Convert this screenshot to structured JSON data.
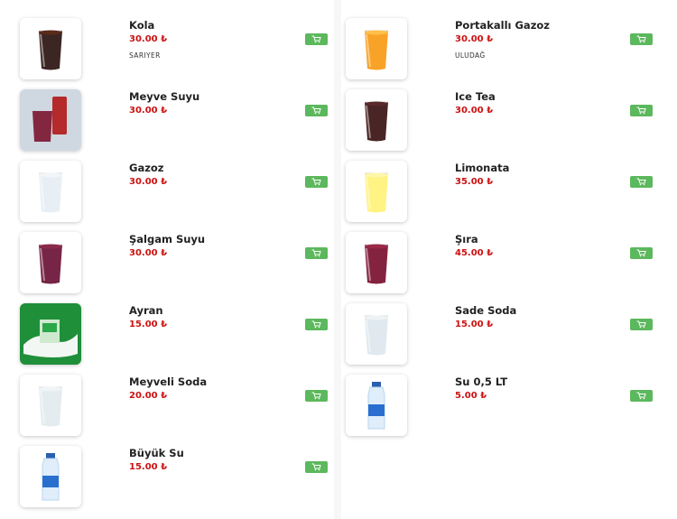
{
  "left_column": [
    {
      "name": "Kola",
      "price": "30.00 ₺",
      "brand": "SARIYER",
      "icon": "cola-glass-icon"
    },
    {
      "name": "Meyve Suyu",
      "price": "30.00 ₺",
      "brand": "",
      "icon": "juice-can-icon"
    },
    {
      "name": "Gazoz",
      "price": "30.00 ₺",
      "brand": "",
      "icon": "clear-soda-glass-icon"
    },
    {
      "name": "Şalgam Suyu",
      "price": "30.00 ₺",
      "brand": "",
      "icon": "turnip-juice-glass-icon"
    },
    {
      "name": "Ayran",
      "price": "15.00 ₺",
      "brand": "",
      "icon": "ayran-splash-icon"
    },
    {
      "name": "Meyveli Soda",
      "price": "20.00 ₺",
      "brand": "",
      "icon": "fruit-soda-glass-icon"
    },
    {
      "name": "Büyük Su",
      "price": "15.00 ₺",
      "brand": "",
      "icon": "large-water-bottle-icon"
    }
  ],
  "right_column": [
    {
      "name": "Portakallı Gazoz",
      "price": "30.00 ₺",
      "brand": "ULUDAĞ",
      "icon": "orange-soda-glass-icon"
    },
    {
      "name": "Ice Tea",
      "price": "30.00 ₺",
      "brand": "",
      "icon": "ice-tea-glass-icon"
    },
    {
      "name": "Limonata",
      "price": "35.00 ₺",
      "brand": "",
      "icon": "lemonade-glass-icon"
    },
    {
      "name": "Şıra",
      "price": "45.00 ₺",
      "brand": "",
      "icon": "sira-glass-icon"
    },
    {
      "name": "Sade Soda",
      "price": "15.00 ₺",
      "brand": "",
      "icon": "plain-soda-glass-icon"
    },
    {
      "name": "Su 0,5 LT",
      "price": "5.00 ₺",
      "brand": "",
      "icon": "water-bottle-icon"
    }
  ],
  "cart_icon": "cart-icon",
  "colors": {
    "price": "#cc1111",
    "cart_button": "#5cb85c"
  }
}
